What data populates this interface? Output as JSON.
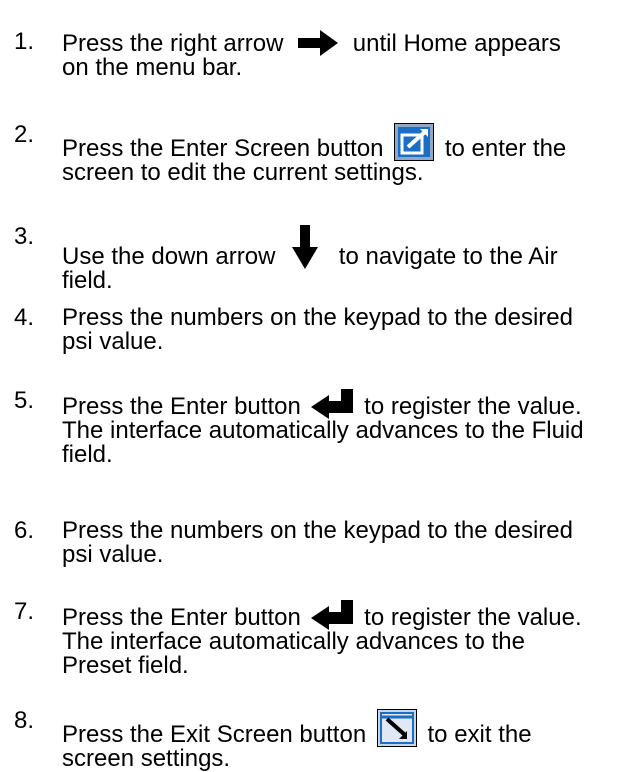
{
  "steps": [
    {
      "number": "1.",
      "before": "Press the right arrow",
      "icon": "right-arrow-icon",
      "after": "until Home appears",
      "line2": "on the menu bar."
    },
    {
      "number": "2.",
      "before": "Press the Enter Screen button",
      "icon": "enter-screen-icon",
      "after": "to enter the",
      "line2": "screen to edit the current settings."
    },
    {
      "number": "3.",
      "before": "Use the down arrow",
      "icon": "down-arrow-icon",
      "after": "to navigate to the Air",
      "line2": "field."
    },
    {
      "number": "4.",
      "line1": "Press the numbers on the keypad to the desired",
      "line2": "psi value."
    },
    {
      "number": "5.",
      "before": "Press the Enter button",
      "icon": "enter-icon",
      "after": "to register the value.",
      "line2": "The interface automatically advances to the Fluid",
      "line3": "field."
    },
    {
      "number": "6.",
      "line1": "Press the numbers on the keypad to the desired",
      "line2": "psi value."
    },
    {
      "number": "7.",
      "before": "Press the Enter button",
      "icon": "enter-icon",
      "after": "to register the value.",
      "line2": "The interface automatically advances to the",
      "line3": "Preset field."
    },
    {
      "number": "8.",
      "before": "Press the Exit Screen button",
      "icon": "exit-screen-icon",
      "after": "to exit the",
      "line2": "screen settings."
    }
  ],
  "colors": {
    "text": "#000000",
    "icon_blue": "#1a6fc4",
    "icon_light": "#c9d6e8"
  }
}
